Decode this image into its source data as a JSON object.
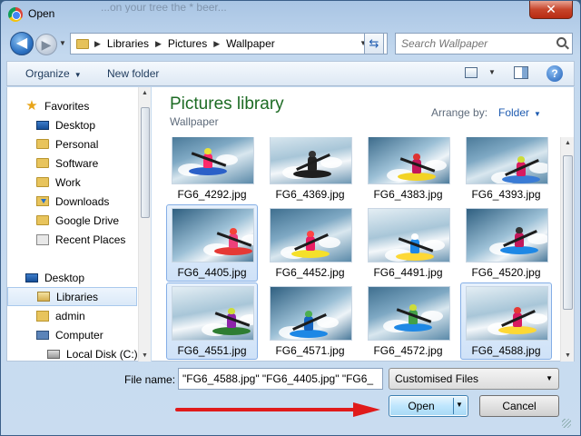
{
  "window": {
    "title": "Open",
    "close_glyph": "✕",
    "background_text": "...on your tree the * beer..."
  },
  "nav": {
    "back_glyph": "◀",
    "forward_glyph": "▶",
    "breadcrumbs": [
      "Libraries",
      "Pictures",
      "Wallpaper"
    ],
    "search_placeholder": "Search Wallpaper"
  },
  "toolbar": {
    "organize_label": "Organize",
    "new_folder_label": "New folder",
    "help_glyph": "?"
  },
  "sidebar": {
    "favorites_label": "Favorites",
    "items": [
      {
        "label": "Desktop",
        "icon": "desktop-icon"
      },
      {
        "label": "Personal",
        "icon": "folder-icon"
      },
      {
        "label": "Software",
        "icon": "folder-icon"
      },
      {
        "label": "Work",
        "icon": "folder-icon"
      },
      {
        "label": "Downloads",
        "icon": "downloads-icon"
      },
      {
        "label": "Google Drive",
        "icon": "folder-icon"
      },
      {
        "label": "Recent Places",
        "icon": "recent-places-icon"
      }
    ],
    "tree": [
      {
        "label": "Desktop",
        "icon": "desktop-icon"
      },
      {
        "label": "Libraries",
        "icon": "library-icon",
        "selected": true
      },
      {
        "label": "admin",
        "icon": "user-folder-icon"
      },
      {
        "label": "Computer",
        "icon": "computer-icon"
      },
      {
        "label": "Local Disk (C:)",
        "icon": "disk-icon"
      }
    ]
  },
  "content": {
    "library_title": "Pictures library",
    "library_subtitle": "Wallpaper",
    "arrange_label": "Arrange by:",
    "arrange_value": "Folder",
    "files": [
      {
        "name": "FG6_4292.jpg",
        "selected": false,
        "boat": "#2b60c8",
        "jacket": "#ff2a6a",
        "helmet": "#e8e23a"
      },
      {
        "name": "FG6_4369.jpg",
        "selected": false,
        "boat": "#1e1e1e",
        "jacket": "#222222",
        "helmet": "#333333"
      },
      {
        "name": "FG6_4383.jpg",
        "selected": false,
        "boat": "#f2d326",
        "jacket": "#c2185b",
        "helmet": "#d33"
      },
      {
        "name": "FG6_4393.jpg",
        "selected": false,
        "boat": "#3a7bd5",
        "jacket": "#d81b60",
        "helmet": "#cddc39"
      },
      {
        "name": "FG6_4405.jpg",
        "selected": true,
        "boat": "#e53935",
        "jacket": "#ec407a",
        "helmet": "#f44336"
      },
      {
        "name": "FG6_4452.jpg",
        "selected": false,
        "boat": "#f5e02a",
        "jacket": "#e91e63",
        "helmet": "#f44"
      },
      {
        "name": "FG6_4491.jpg",
        "selected": false,
        "boat": "#fdd835",
        "jacket": "#1e88e5",
        "helmet": "#fff"
      },
      {
        "name": "FG6_4520.jpg",
        "selected": false,
        "boat": "#1e88e5",
        "jacket": "#c2185b",
        "helmet": "#333"
      },
      {
        "name": "FG6_4551.jpg",
        "selected": true,
        "boat": "#2e7d32",
        "jacket": "#8e24aa",
        "helmet": "#cddc39"
      },
      {
        "name": "FG6_4571.jpg",
        "selected": false,
        "boat": "#1e88e5",
        "jacket": "#1565c0",
        "helmet": "#4caf50"
      },
      {
        "name": "FG6_4572.jpg",
        "selected": false,
        "boat": "#1e88e5",
        "jacket": "#43a047",
        "helmet": "#cddc39"
      },
      {
        "name": "FG6_4588.jpg",
        "selected": true,
        "boat": "#fdd835",
        "jacket": "#d81b60",
        "helmet": "#e53935"
      }
    ]
  },
  "footer": {
    "file_name_label": "File name:",
    "file_name_value": "\"FG6_4588.jpg\" \"FG6_4405.jpg\" \"FG6_",
    "filter_value": "Customised Files",
    "open_label": "Open",
    "cancel_label": "Cancel"
  },
  "colors": {
    "accent_arrow": "#e01b1b",
    "library_title": "#1d6b24",
    "selection": "#cfe2f8"
  }
}
